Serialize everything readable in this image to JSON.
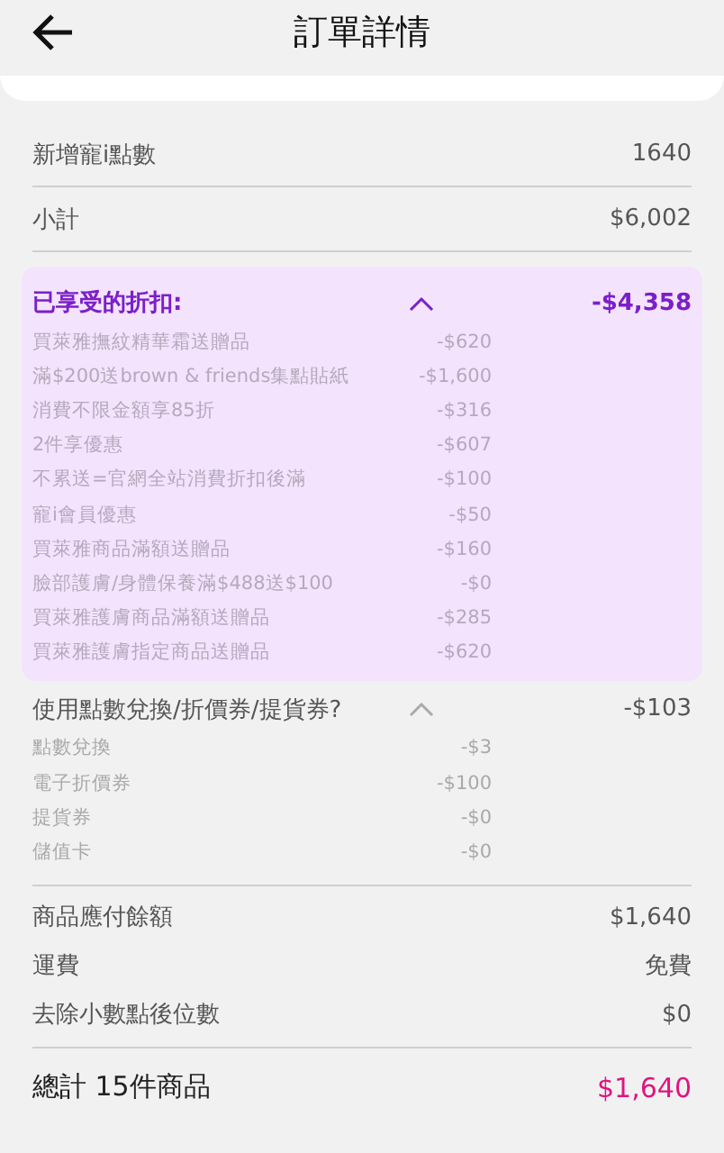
{
  "header": {
    "title": "訂單詳情"
  },
  "rows_top": [
    {
      "label": "新增寵i點數",
      "value": "1640"
    },
    {
      "label": "小計",
      "value": "$6,002"
    }
  ],
  "discounts": {
    "label": "已享受的折扣:",
    "total": "-$4,358",
    "expanded": true,
    "items": [
      {
        "label": "買萊雅撫紋精華霜送贈品",
        "amount": "-$620"
      },
      {
        "label": "滿$200送brown & friends集點貼紙",
        "amount": "-$1,600"
      },
      {
        "label": "消費不限金額享85折",
        "amount": "-$316"
      },
      {
        "label": "2件享優惠",
        "amount": "-$607"
      },
      {
        "label": "不累送=官網全站消費折扣後滿",
        "amount": "-$100"
      },
      {
        "label": "寵i會員優惠",
        "amount": "-$50"
      },
      {
        "label": "買萊雅商品滿額送贈品",
        "amount": "-$160"
      },
      {
        "label": "臉部護膚/身體保養滿$488送$100",
        "amount": "-$0"
      },
      {
        "label": "買萊雅護膚商品滿額送贈品",
        "amount": "-$285"
      },
      {
        "label": "買萊雅護膚指定商品送贈品",
        "amount": "-$620"
      }
    ]
  },
  "vouchers": {
    "label": "使用點數兌換/折價券/提貨券?",
    "total": "-$103",
    "expanded": true,
    "items": [
      {
        "label": "點數兌換",
        "amount": "-$3"
      },
      {
        "label": "電子折價券",
        "amount": "-$100"
      },
      {
        "label": "提貨券",
        "amount": "-$0"
      },
      {
        "label": "儲值卡",
        "amount": "-$0"
      }
    ]
  },
  "rows_bottom": [
    {
      "label": "商品應付餘額",
      "value": "$1,640"
    },
    {
      "label": "運費",
      "value": "免費"
    },
    {
      "label": "去除小數點後位數",
      "value": "$0"
    }
  ],
  "total": {
    "label": "總計 15件商品",
    "value": "$1,640"
  }
}
